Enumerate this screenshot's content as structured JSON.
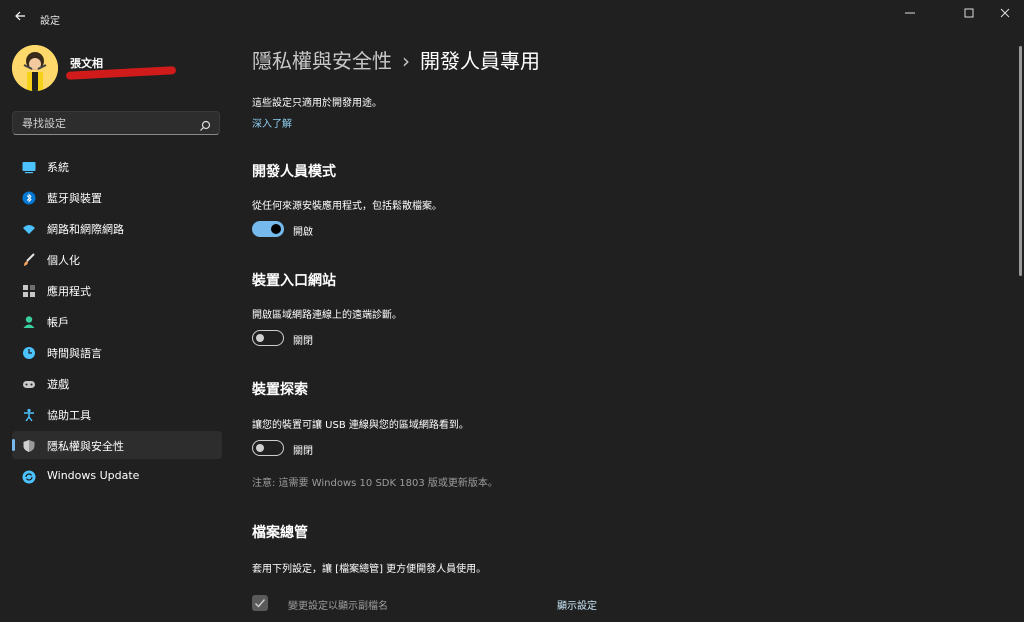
{
  "window": {
    "title": "設定",
    "back_icon": "back-arrow-icon",
    "minimize_icon": "minimize-icon",
    "maximize_icon": "maximize-icon",
    "close_icon": "close-icon"
  },
  "profile": {
    "name": "張文相",
    "avatar_icon": "avatar-image"
  },
  "search": {
    "placeholder": "尋找設定",
    "icon": "search-icon"
  },
  "sidebar": {
    "items": [
      {
        "label": "系統",
        "icon": "system-icon",
        "color": "#4cc2ff"
      },
      {
        "label": "藍牙與裝置",
        "icon": "bluetooth-icon",
        "color": "#0078d4"
      },
      {
        "label": "網路和網際網路",
        "icon": "wifi-icon",
        "color": "#4cc2ff"
      },
      {
        "label": "個人化",
        "icon": "brush-icon",
        "color": "#f7a35c"
      },
      {
        "label": "應用程式",
        "icon": "apps-icon",
        "color": "#c8c8c8"
      },
      {
        "label": "帳戶",
        "icon": "account-icon",
        "color": "#3ad0a0"
      },
      {
        "label": "時間與語言",
        "icon": "time-language-icon",
        "color": "#4cc2ff"
      },
      {
        "label": "遊戲",
        "icon": "gaming-icon",
        "color": "#c8c8c8"
      },
      {
        "label": "協助工具",
        "icon": "accessibility-icon",
        "color": "#4cc2ff"
      },
      {
        "label": "隱私權與安全性",
        "icon": "shield-icon",
        "color": "#9a9a9a",
        "active": true
      },
      {
        "label": "Windows Update",
        "icon": "windows-update-icon",
        "color": "#4cc2ff"
      }
    ]
  },
  "main": {
    "breadcrumb": {
      "parent": "隱私權與安全性",
      "separator": "›",
      "current": "開發人員專用"
    },
    "intro": "這些設定只適用於開發用途。",
    "learn_more": "深入了解",
    "sections": {
      "developer_mode": {
        "title": "開發人員模式",
        "desc": "從任何來源安裝應用程式，包括鬆散檔案。",
        "state": "開啟",
        "on": true
      },
      "device_portal": {
        "title": "裝置入口網站",
        "desc": "開啟區域網路連線上的遠端診斷。",
        "state": "關閉",
        "on": false
      },
      "device_discovery": {
        "title": "裝置探索",
        "desc": "讓您的裝置可讓 USB 連線與您的區域網路看到。",
        "state": "關閉",
        "on": false,
        "note": "注意: 這需要 Windows 10 SDK 1803 版或更新版本。"
      },
      "file_explorer": {
        "title": "檔案總管",
        "desc": "套用下列設定，讓 [檔案總管] 更方便開發人員使用。",
        "checkbox_label": "變更設定以顯示副檔名",
        "checked": true,
        "show_settings": "顯示設定"
      }
    }
  },
  "accent_color": "#76b9ed"
}
